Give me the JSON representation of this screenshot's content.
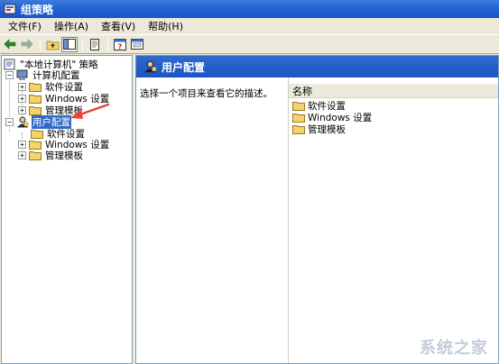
{
  "window": {
    "title": "组策略"
  },
  "menu": {
    "items": [
      "文件(F)",
      "操作(A)",
      "查看(V)",
      "帮助(H)"
    ]
  },
  "toolbar": {
    "icons": [
      "back-icon",
      "forward-icon",
      "up-folder-icon",
      "show-hide-tree-icon",
      "export-list-icon",
      "help-icon",
      "properties-icon"
    ]
  },
  "tree": {
    "root": "\"本地计算机\" 策略",
    "computer_config": "计算机配置",
    "computer_children": [
      "软件设置",
      "Windows 设置",
      "管理模板"
    ],
    "user_config": "用户配置",
    "user_children": [
      "软件设置",
      "Windows 设置",
      "管理模板"
    ]
  },
  "right": {
    "header_title": "用户配置",
    "description": "选择一个项目来查看它的描述。",
    "column_name": "名称",
    "items": [
      "软件设置",
      "Windows 设置",
      "管理模板"
    ]
  },
  "watermark": "系统之家",
  "colors": {
    "selection": "#316ac5",
    "titlebar": "#2563d6",
    "annotation_arrow": "#e8443a"
  }
}
